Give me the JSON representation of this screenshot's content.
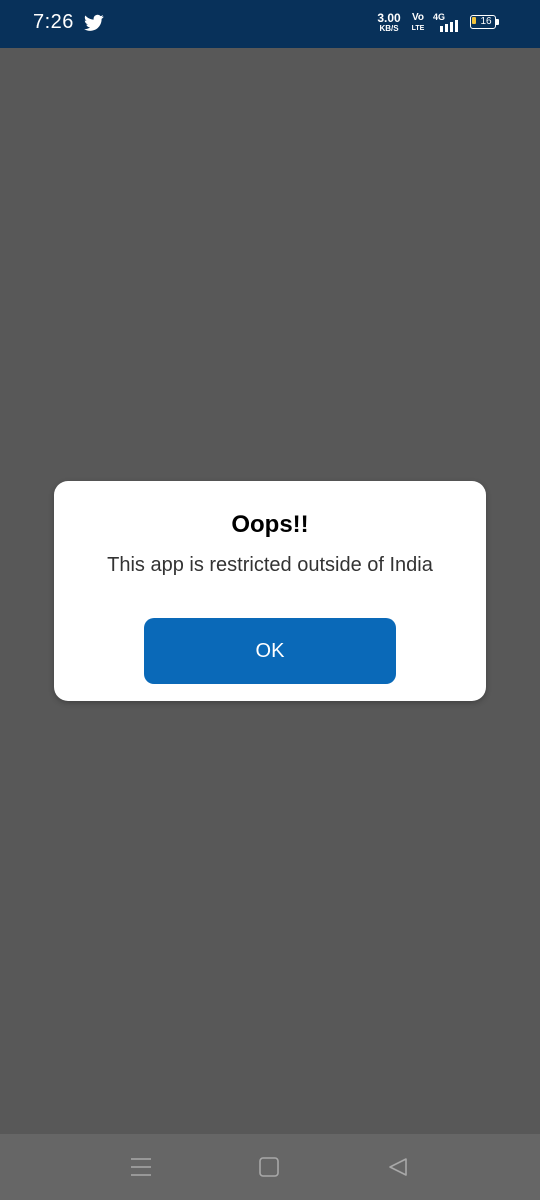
{
  "status_bar": {
    "time": "7:26",
    "notification_icon": "twitter-icon",
    "net_speed_value": "3.00",
    "net_speed_unit": "KB/S",
    "volte_top": "Vo",
    "volte_bottom": "LTE",
    "network_type": "4G",
    "battery_level": "16",
    "background_color": "#08315a"
  },
  "dialog": {
    "title": "Oops!!",
    "message": "This app is restricted outside of India",
    "ok_label": "OK",
    "button_color": "#0a69b8"
  },
  "navigation_bar": {
    "icons": [
      "menu-icon",
      "home-icon",
      "back-icon"
    ]
  }
}
